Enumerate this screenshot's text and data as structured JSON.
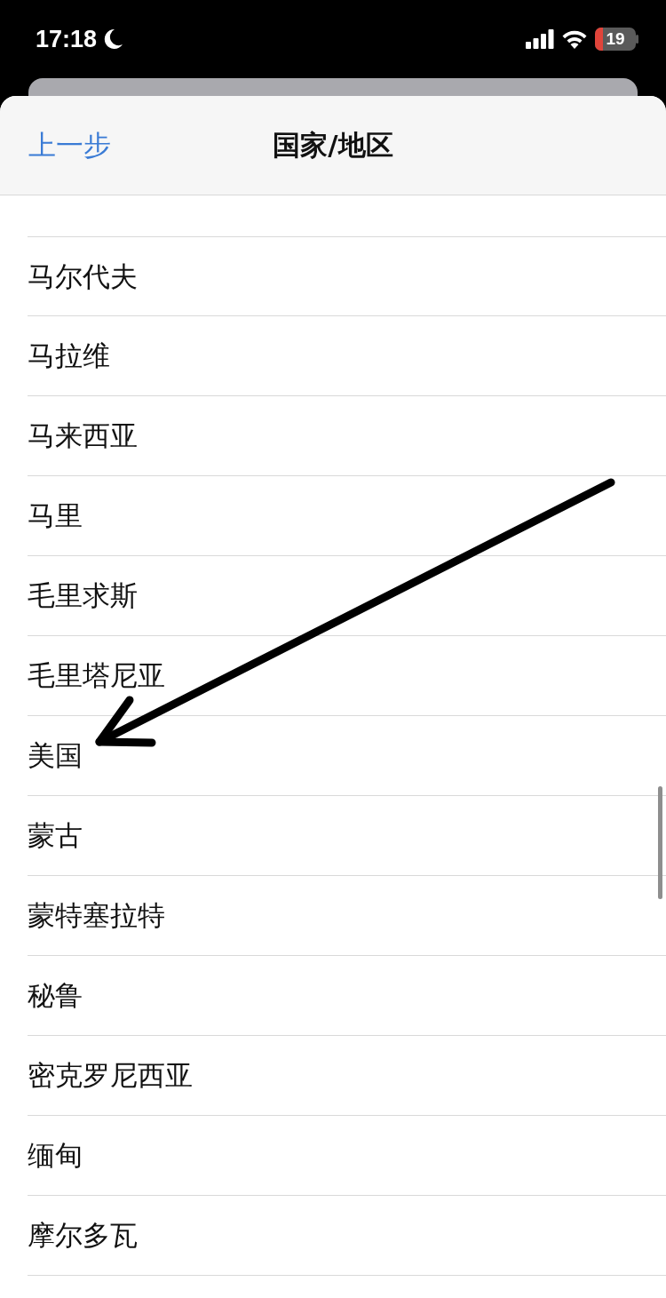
{
  "status_bar": {
    "time": "17:18",
    "battery": "19"
  },
  "header": {
    "back": "上一步",
    "title": "国家/地区"
  },
  "countries": [
    {
      "name": "马尔代夫"
    },
    {
      "name": "马拉维"
    },
    {
      "name": "马来西亚"
    },
    {
      "name": "马里"
    },
    {
      "name": "毛里求斯"
    },
    {
      "name": "毛里塔尼亚"
    },
    {
      "name": "美国"
    },
    {
      "name": "蒙古"
    },
    {
      "name": "蒙特塞拉特"
    },
    {
      "name": "秘鲁"
    },
    {
      "name": "密克罗尼西亚"
    },
    {
      "name": "缅甸"
    },
    {
      "name": "摩尔多瓦"
    }
  ]
}
